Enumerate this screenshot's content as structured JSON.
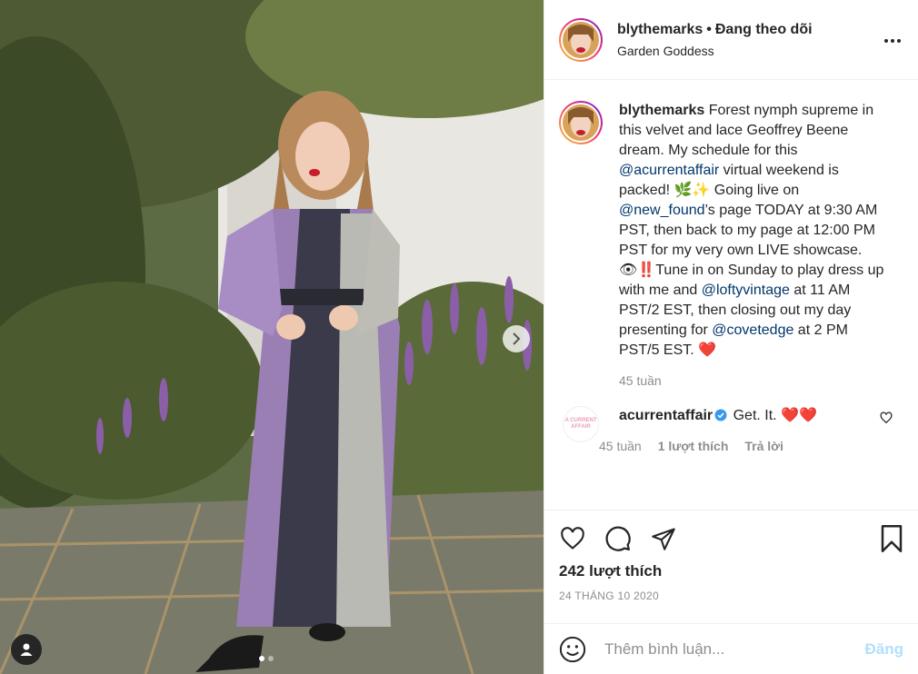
{
  "header": {
    "username": "blythemarks",
    "separator": "•",
    "follow_status": "Đang theo dõi",
    "location": "Garden Goddess"
  },
  "caption": {
    "username": "blythemarks",
    "text_1": "Forest nymph supreme in this velvet and lace Geoffrey Beene dream. My schedule for this ",
    "mention_1": "@acurrentaffair",
    "text_2": " virtual weekend is packed! 🌿✨ Going live on ",
    "mention_2": "@new_found",
    "text_3": "’s page TODAY at 9:30 AM PST, then back to my page at 12:00 PM PST for my very own LIVE showcase. 👁‼️Tune in on Sunday to play dress up with me and ",
    "mention_3": "@loftyvintage",
    "text_4": " at 11 AM PST/2 EST, then closing out my day presenting for ",
    "mention_4": "@covetedge",
    "text_5": " at 2 PM PST/5 EST. ❤️",
    "time": "45 tuần"
  },
  "comment": {
    "avatar_text": "A CURRENT AFFAIR",
    "username": "acurrentaffair",
    "text": "Get. It. ❤️❤️",
    "time": "45 tuần",
    "likes": "1 lượt thích",
    "reply": "Trả lời"
  },
  "stats": {
    "likes": "242 lượt thích",
    "date": "24 THÁNG 10 2020"
  },
  "composer": {
    "placeholder": "Thêm bình luận...",
    "post_label": "Đăng"
  },
  "carousel": {
    "slide_count": 2,
    "active_slide": 1
  },
  "colors": {
    "link": "#00376b",
    "secondary_text": "#8e8e8e",
    "post_button": "#b2dffc",
    "border": "#efefef"
  },
  "icons": [
    "more-icon",
    "heart-icon",
    "comment-icon",
    "share-icon",
    "bookmark-icon",
    "emoji-icon",
    "chevron-right-icon",
    "user-tag-icon",
    "verified-icon"
  ]
}
